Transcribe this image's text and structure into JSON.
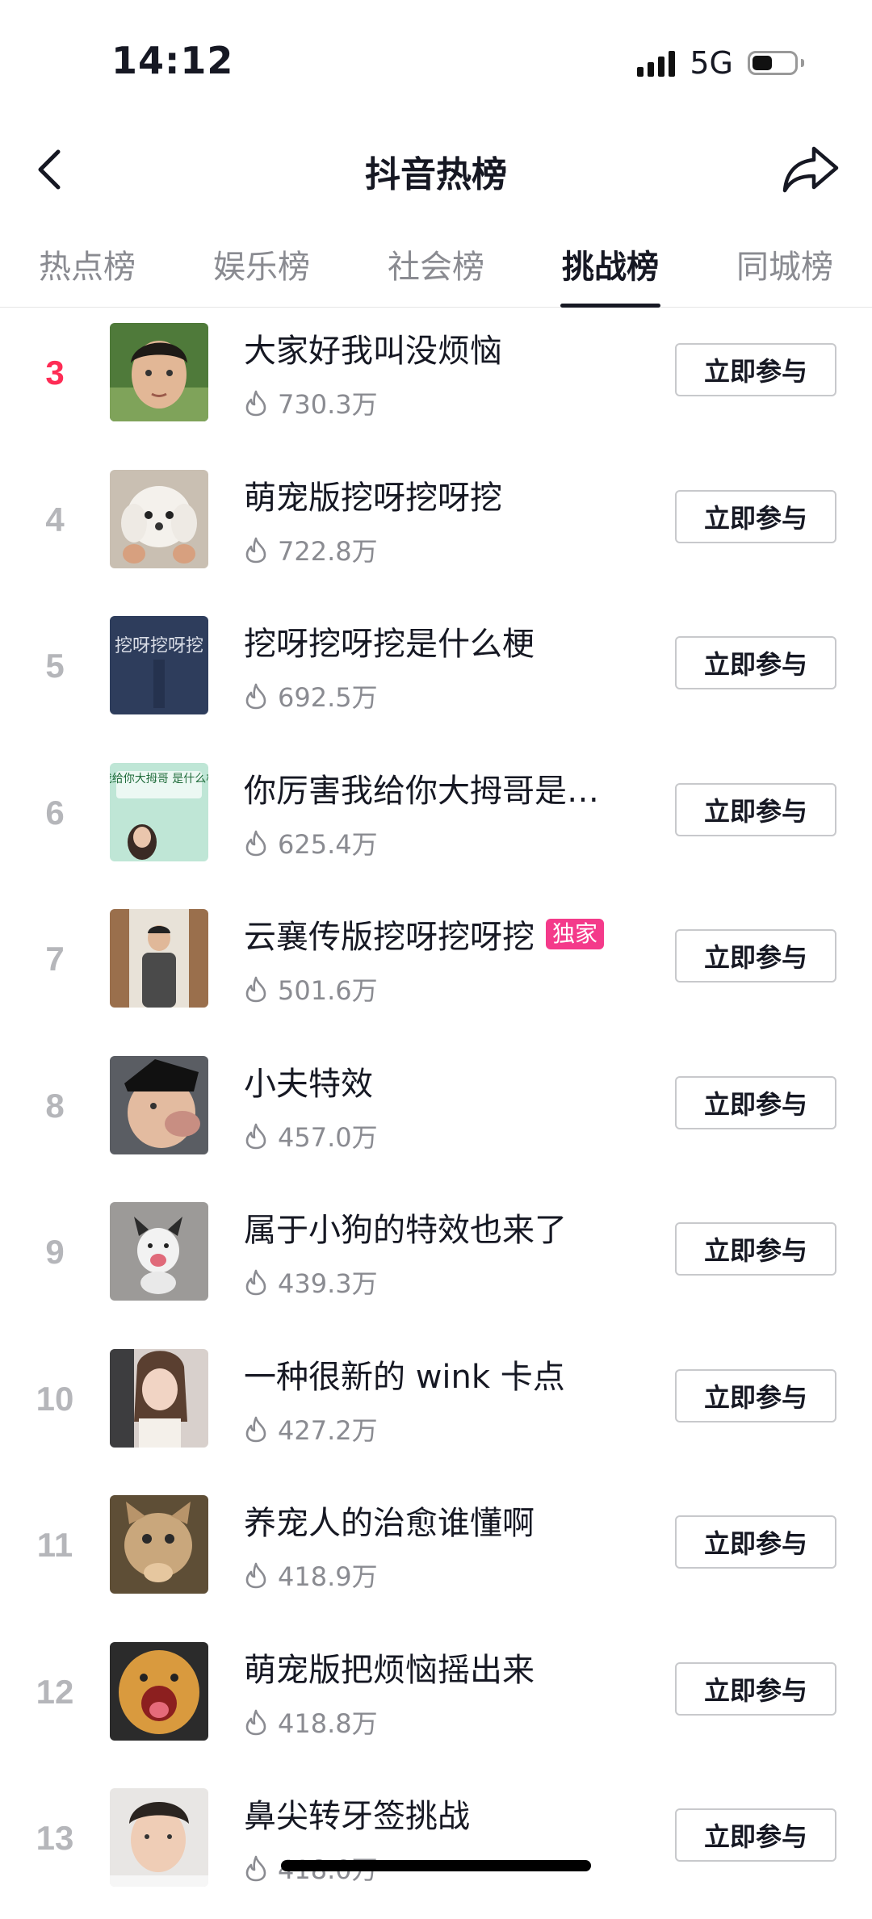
{
  "status_bar": {
    "time": "14:12",
    "network": "5G"
  },
  "header": {
    "title": "抖音热榜"
  },
  "tabs": [
    {
      "label": "热点榜",
      "active": false
    },
    {
      "label": "娱乐榜",
      "active": false
    },
    {
      "label": "社会榜",
      "active": false
    },
    {
      "label": "挑战榜",
      "active": true
    },
    {
      "label": "同城榜",
      "active": false
    }
  ],
  "list": {
    "items": [
      {
        "rank": "3",
        "title": "大家好我叫没烦恼",
        "heat": "730.3万",
        "button": "立即参与",
        "hot": true
      },
      {
        "rank": "4",
        "title": "萌宠版挖呀挖呀挖",
        "heat": "722.8万",
        "button": "立即参与"
      },
      {
        "rank": "5",
        "title": "挖呀挖呀挖是什么梗",
        "heat": "692.5万",
        "button": "立即参与",
        "thumb_text": "挖呀挖呀挖"
      },
      {
        "rank": "6",
        "title": "你厉害我给你大拇哥是…",
        "heat": "625.4万",
        "button": "立即参与",
        "thumb_text": "我给你大拇哥 是什么梗"
      },
      {
        "rank": "7",
        "title": "云襄传版挖呀挖呀挖",
        "heat": "501.6万",
        "button": "立即参与",
        "badge": "独家"
      },
      {
        "rank": "8",
        "title": "小夫特效",
        "heat": "457.0万",
        "button": "立即参与"
      },
      {
        "rank": "9",
        "title": "属于小狗的特效也来了",
        "heat": "439.3万",
        "button": "立即参与"
      },
      {
        "rank": "10",
        "title": "一种很新的 wink 卡点",
        "heat": "427.2万",
        "button": "立即参与"
      },
      {
        "rank": "11",
        "title": "养宠人的治愈谁懂啊",
        "heat": "418.9万",
        "button": "立即参与"
      },
      {
        "rank": "12",
        "title": "萌宠版把烦恼摇出来",
        "heat": "418.8万",
        "button": "立即参与"
      },
      {
        "rank": "13",
        "title": "鼻尖转牙签挑战",
        "heat": "418.0万",
        "button": "立即参与"
      }
    ]
  }
}
